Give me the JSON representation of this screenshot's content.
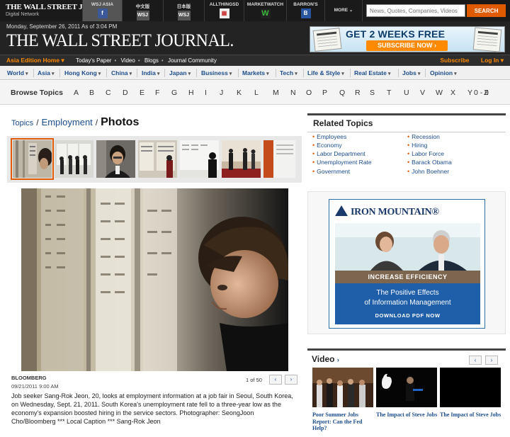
{
  "network": {
    "logo_title": "THE WALL STREET JOURNAL.",
    "logo_sub": "Digital Network",
    "tabs": [
      {
        "label": "WSJ ASIA",
        "icon": "facebook-icon",
        "glyph": "f",
        "color": "#3b5998"
      },
      {
        "label": "中文版",
        "icon": "wsj-chinese-icon",
        "glyph": "WSJ",
        "color": "#444"
      },
      {
        "label": "日本版",
        "icon": "wsj-japan-icon",
        "glyph": "WSJ",
        "color": "#444"
      },
      {
        "label": "ALLTHINGSD",
        "icon": "allthingsd-icon",
        "glyph": "▦",
        "color": "#c33"
      },
      {
        "label": "MARKETWATCH",
        "icon": "marketwatch-icon",
        "glyph": "W",
        "color": "#2a9a2a"
      },
      {
        "label": "BARRON'S",
        "icon": "barrons-icon",
        "glyph": "B",
        "color": "#2a55a0"
      }
    ],
    "more_label": "MORE",
    "search_placeholder": "News, Quotes, Companies, Videos",
    "search_button": "SEARCH"
  },
  "masthead": {
    "dateline": "Monday, September 26, 2011 As of 3:04 PM",
    "title": "THE WALL STREET JOURNAL.",
    "promo_headline": "GET 2 WEEKS FREE",
    "promo_button": "SUBSCRIBE NOW ›"
  },
  "edition_bar": {
    "edition": "Asia Edition Home ▾",
    "links": [
      "Today's Paper",
      "Video",
      "Blogs",
      "Journal Community"
    ],
    "subscribe": "Subscribe",
    "login": "Log In ▾"
  },
  "sections": [
    "World",
    "Asia",
    "Hong Kong",
    "China",
    "India",
    "Japan",
    "Business",
    "Markets",
    "Tech",
    "Life & Style",
    "Real Estate",
    "Jobs",
    "Opinion"
  ],
  "browse": {
    "label": "Browse Topics",
    "letters": [
      "A",
      "B",
      "C",
      "D",
      "E",
      "F",
      "G",
      "H",
      "I",
      "J",
      "K",
      "L",
      "M",
      "N",
      "O",
      "P",
      "Q",
      "R",
      "S",
      "T",
      "U",
      "V",
      "W",
      "X",
      "Y",
      "Z",
      "0 - 9"
    ]
  },
  "breadcrumb": {
    "topics": "Topics",
    "employment": "Employment",
    "current": "Photos"
  },
  "slideshow": {
    "credit": "BLOOMBERG",
    "date": "09/21/2011 9:00 AM",
    "counter": "1 of 50",
    "prev": "‹",
    "next": "›",
    "caption": "Job seeker Sang-Rok Jeon, 20, looks at employment information at a job fair in Seoul, South Korea, on Wednesday, Sept. 21, 2011. South Korea's unemployment rate fell to a three-year low as the economy's expansion boosted hiring in the service sectors. Photographer: SeongJoon Cho/Bloomberg *** Local Caption *** Sang-Rok Jeon"
  },
  "related": {
    "heading": "Related Topics",
    "left": [
      "Employees",
      "Economy",
      "Labor Department",
      "Unemployment Rate",
      "Government"
    ],
    "right": [
      "Recession",
      "Hiring",
      "Labor Force",
      "Barack Obama",
      "John Boehner"
    ]
  },
  "ad": {
    "brand": "IRON MOUNTAIN®",
    "band": "INCREASE EFFICIENCY",
    "line1": "The Positive Effects",
    "line2": "of Information Management",
    "cta": "DOWNLOAD PDF NOW"
  },
  "video": {
    "heading": "Video",
    "heading_arrow": "›",
    "prev": "‹",
    "next": "›",
    "items": [
      {
        "title": "Poor Summer Jobs Report: Can the Fed Help?"
      },
      {
        "title": "The Impact of Steve Jobs"
      },
      {
        "title": "The Impact of Steve Jobs"
      }
    ]
  }
}
